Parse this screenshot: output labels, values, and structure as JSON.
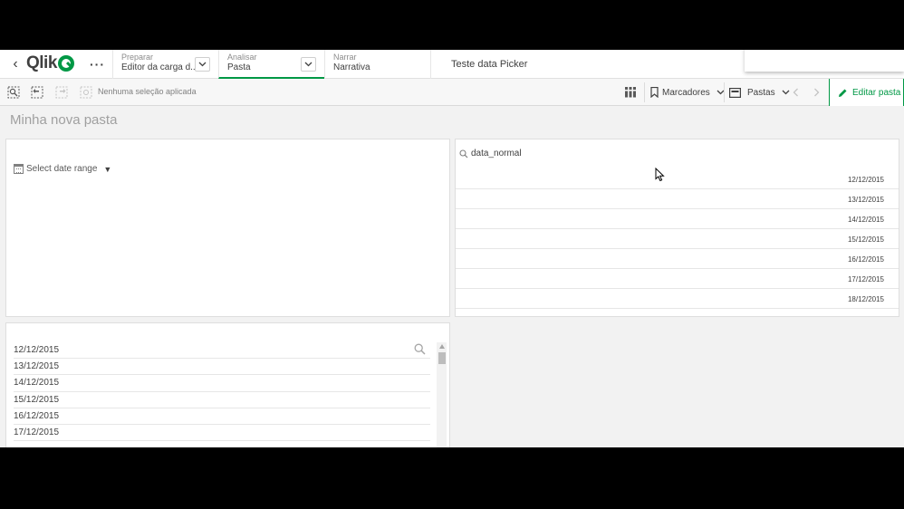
{
  "nav": {
    "back_icon": "chevron-left-icon",
    "logo_text": "Qlik",
    "more_icon": "ellipsis-icon",
    "tabs": [
      {
        "small": "Preparar",
        "main": "Editor da carga d..."
      },
      {
        "small": "Analisar",
        "main": "Pasta"
      },
      {
        "small": "Narrar",
        "main": "Narrativa"
      }
    ],
    "app_title": "Teste data Picker",
    "accent": "#009845"
  },
  "toolbar": {
    "no_selection": "Nenhuma seleção aplicada",
    "bookmarks_label": "Marcadores",
    "sheets_label": "Pastas",
    "edit_label": "Editar pasta"
  },
  "sheet": {
    "title": "Minha nova pasta"
  },
  "date_picker": {
    "label": "Select date range",
    "icon": "calendar-icon"
  },
  "table": {
    "header": "data_normal",
    "rows": [
      "12/12/2015",
      "13/12/2015",
      "14/12/2015",
      "15/12/2015",
      "16/12/2015",
      "17/12/2015",
      "18/12/2015"
    ]
  },
  "filter": {
    "rows": [
      "12/12/2015",
      "13/12/2015",
      "14/12/2015",
      "15/12/2015",
      "16/12/2015",
      "17/12/2015"
    ]
  }
}
